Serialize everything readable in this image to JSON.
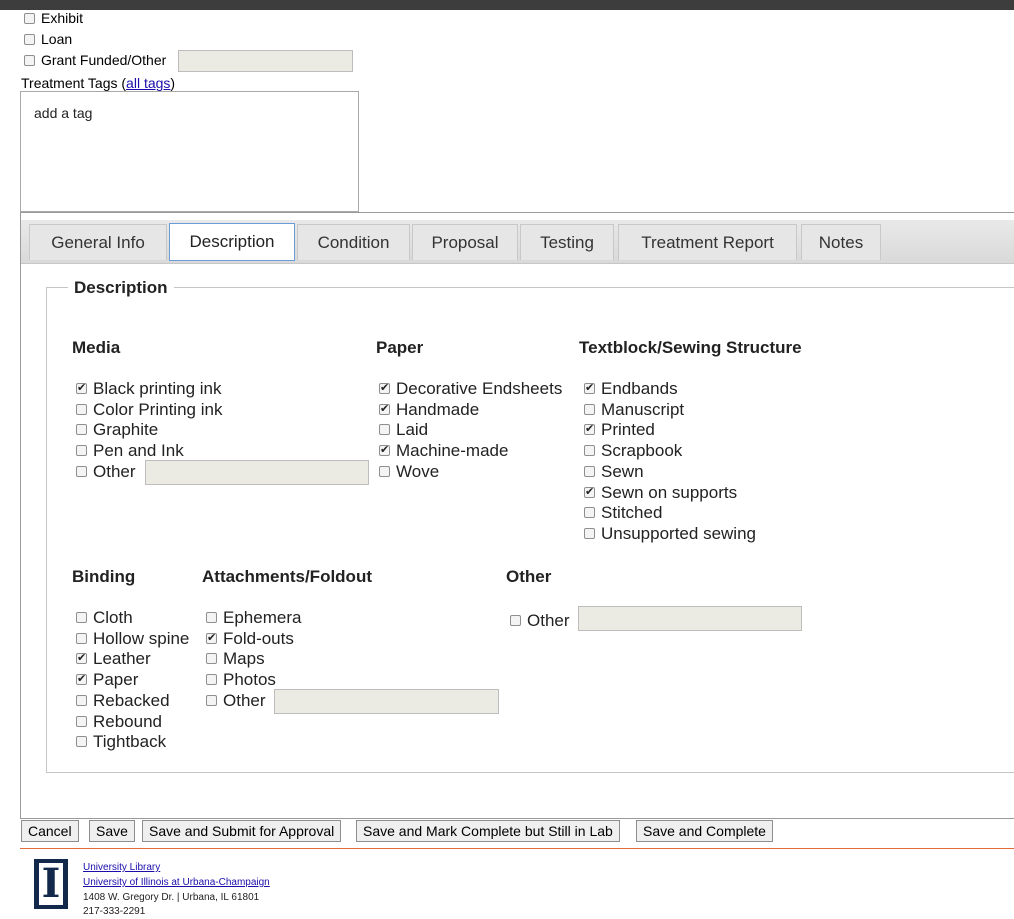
{
  "top_checkboxes": [
    {
      "label": "Exhibit",
      "checked": false
    },
    {
      "label": "Loan",
      "checked": false
    },
    {
      "label": "Grant Funded/Other",
      "checked": false
    }
  ],
  "tags": {
    "label": "Treatment Tags (",
    "link": "all tags",
    "label_end": ")",
    "placeholder": "add a tag"
  },
  "tabs": [
    "General Info",
    "Description",
    "Condition",
    "Proposal",
    "Testing",
    "Treatment Report",
    "Notes"
  ],
  "active_tab": "Description",
  "section_title": "Description",
  "groups": {
    "media": {
      "title": "Media",
      "options": [
        {
          "label": "Black printing ink",
          "checked": true
        },
        {
          "label": "Color Printing ink",
          "checked": false
        },
        {
          "label": "Graphite",
          "checked": false
        },
        {
          "label": "Pen and Ink",
          "checked": false
        },
        {
          "label": "Other",
          "checked": false
        }
      ]
    },
    "paper": {
      "title": "Paper",
      "options": [
        {
          "label": "Decorative Endsheets",
          "checked": true
        },
        {
          "label": "Handmade",
          "checked": true
        },
        {
          "label": "Laid",
          "checked": false
        },
        {
          "label": "Machine-made",
          "checked": true
        },
        {
          "label": "Wove",
          "checked": false
        }
      ]
    },
    "textblock": {
      "title": "Textblock/Sewing Structure",
      "options": [
        {
          "label": "Endbands",
          "checked": true
        },
        {
          "label": "Manuscript",
          "checked": false
        },
        {
          "label": "Printed",
          "checked": true
        },
        {
          "label": "Scrapbook",
          "checked": false
        },
        {
          "label": "Sewn",
          "checked": false
        },
        {
          "label": "Sewn on supports",
          "checked": true
        },
        {
          "label": "Stitched",
          "checked": false
        },
        {
          "label": "Unsupported sewing",
          "checked": false
        }
      ]
    },
    "binding": {
      "title": "Binding",
      "options": [
        {
          "label": "Cloth",
          "checked": false
        },
        {
          "label": "Hollow spine",
          "checked": false
        },
        {
          "label": "Leather",
          "checked": true
        },
        {
          "label": "Paper",
          "checked": true
        },
        {
          "label": "Rebacked",
          "checked": false
        },
        {
          "label": "Rebound",
          "checked": false
        },
        {
          "label": "Tightback",
          "checked": false
        }
      ]
    },
    "attachments": {
      "title": "Attachments/Foldout",
      "options": [
        {
          "label": "Ephemera",
          "checked": false
        },
        {
          "label": "Fold-outs",
          "checked": true
        },
        {
          "label": "Maps",
          "checked": false
        },
        {
          "label": "Photos",
          "checked": false
        },
        {
          "label": "Other",
          "checked": false
        }
      ]
    },
    "other": {
      "title": "Other",
      "options": [
        {
          "label": "Other",
          "checked": false
        }
      ]
    }
  },
  "buttons": [
    "Cancel",
    "Save",
    "Save and Submit for Approval",
    "Save and Mark Complete but Still in Lab",
    "Save and Complete"
  ],
  "footer": {
    "line1": "University Library",
    "line2": "University of Illinois at Urbana-Champaign",
    "address": "1408 W. Gregory Dr. | Urbana, IL 61801",
    "phone": "217-333-2291",
    "logo_letter": "I",
    "logo_color": "#13294b"
  }
}
